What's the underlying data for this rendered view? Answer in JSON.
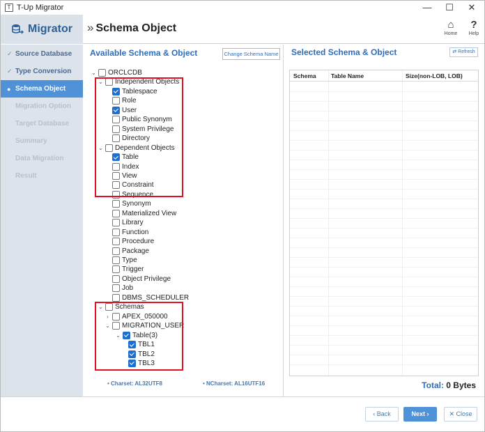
{
  "window": {
    "title": "T-Up Migrator",
    "app_icon_glyph": "T",
    "minimize_glyph": "—",
    "maximize_glyph": "☐",
    "close_glyph": "✕"
  },
  "header": {
    "brand_label": "Migrator",
    "title_prefix": "»",
    "page_title": "Schema Object",
    "home_label": "Home",
    "home_glyph": "⌂",
    "help_label": "Help",
    "help_glyph": "?"
  },
  "sidebar": {
    "check_glyph": "✓",
    "active_bullet": "●",
    "steps": [
      {
        "label": "Source Database",
        "state": "done"
      },
      {
        "label": "Type Conversion",
        "state": "done"
      },
      {
        "label": "Schema Object",
        "state": "active"
      },
      {
        "label": "Migration Option",
        "state": "disabled"
      },
      {
        "label": "Target Database",
        "state": "disabled"
      },
      {
        "label": "Summary",
        "state": "disabled"
      },
      {
        "label": "Data Migration",
        "state": "disabled"
      },
      {
        "label": "Result",
        "state": "disabled"
      }
    ]
  },
  "available": {
    "title": "Available Schema & Object",
    "change_button": "Change Schema Name",
    "tree": [
      {
        "label": "ORCLCDB",
        "level": 0,
        "twisty": "v",
        "checked": false
      },
      {
        "label": "Independent Objects",
        "level": 1,
        "twisty": "v",
        "checked": false
      },
      {
        "label": "Tablespace",
        "level": 2,
        "twisty": "",
        "checked": true
      },
      {
        "label": "Role",
        "level": 2,
        "twisty": "",
        "checked": false
      },
      {
        "label": "User",
        "level": 2,
        "twisty": "",
        "checked": true
      },
      {
        "label": "Public Synonym",
        "level": 2,
        "twisty": "",
        "checked": false
      },
      {
        "label": "System Privilege",
        "level": 2,
        "twisty": "",
        "checked": false
      },
      {
        "label": "Directory",
        "level": 2,
        "twisty": "",
        "checked": false
      },
      {
        "label": "Dependent Objects",
        "level": 1,
        "twisty": "v",
        "checked": false
      },
      {
        "label": "Table",
        "level": 2,
        "twisty": "",
        "checked": true
      },
      {
        "label": "Index",
        "level": 2,
        "twisty": "",
        "checked": false
      },
      {
        "label": "View",
        "level": 2,
        "twisty": "",
        "checked": false
      },
      {
        "label": "Constraint",
        "level": 2,
        "twisty": "",
        "checked": false
      },
      {
        "label": "Sequence",
        "level": 2,
        "twisty": "",
        "checked": false
      },
      {
        "label": "Synonym",
        "level": 2,
        "twisty": "",
        "checked": false
      },
      {
        "label": "Materialized View",
        "level": 2,
        "twisty": "",
        "checked": false
      },
      {
        "label": "Library",
        "level": 2,
        "twisty": "",
        "checked": false
      },
      {
        "label": "Function",
        "level": 2,
        "twisty": "",
        "checked": false
      },
      {
        "label": "Procedure",
        "level": 2,
        "twisty": "",
        "checked": false
      },
      {
        "label": "Package",
        "level": 2,
        "twisty": "",
        "checked": false
      },
      {
        "label": "Type",
        "level": 2,
        "twisty": "",
        "checked": false
      },
      {
        "label": "Trigger",
        "level": 2,
        "twisty": "",
        "checked": false
      },
      {
        "label": "Object Privilege",
        "level": 2,
        "twisty": "",
        "checked": false
      },
      {
        "label": "Job",
        "level": 2,
        "twisty": "",
        "checked": false
      },
      {
        "label": "DBMS_SCHEDULER",
        "level": 2,
        "twisty": "",
        "checked": false
      },
      {
        "label": "Schemas",
        "level": 1,
        "twisty": "v",
        "checked": false
      },
      {
        "label": "APEX_050000",
        "level": 2,
        "twisty": ">",
        "checked": false
      },
      {
        "label": "MIGRATION_USER",
        "level": 2,
        "twisty": "v",
        "checked": false
      },
      {
        "label": "Table(3)",
        "level": 3,
        "twisty": "v",
        "checked": true
      },
      {
        "label": "TBL1",
        "level": 4,
        "twisty": "",
        "checked": true
      },
      {
        "label": "TBL2",
        "level": 4,
        "twisty": "",
        "checked": true
      },
      {
        "label": "TBL3",
        "level": 4,
        "twisty": "",
        "checked": true
      }
    ],
    "charset": "• Charset: AL32UTF8",
    "ncharset": "• NCharset: AL16UTF16"
  },
  "selected": {
    "title": "Selected Schema & Object",
    "refresh_button": "Refresh",
    "refresh_glyph": "⇄",
    "columns": [
      "Schema",
      "Table Name",
      "Size(non-LOB, LOB)"
    ],
    "total_label": "Total:",
    "total_value": "0 Bytes"
  },
  "footer": {
    "back": "‹ Back",
    "next": "Next ›",
    "close": "✕ Close"
  },
  "colors": {
    "accent": "#4f92d8",
    "title_blue": "#2f6db8",
    "highlight_red": "#e01020",
    "sidebar_bg": "#dde3ea"
  }
}
